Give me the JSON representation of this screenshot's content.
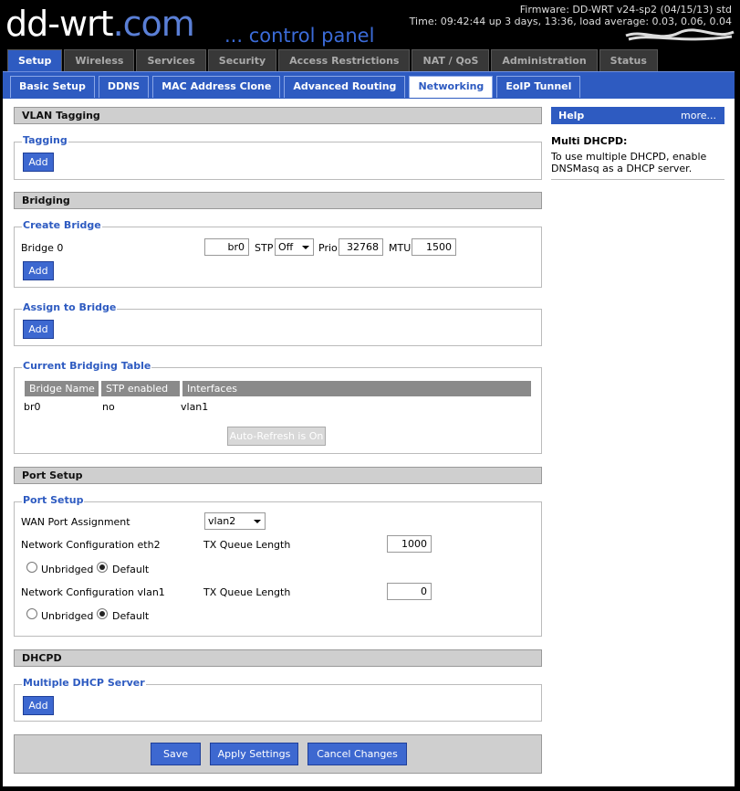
{
  "header": {
    "logo_main": "dd-wrt",
    "logo_dot": ".com",
    "tagline": "... control panel",
    "firmware": "Firmware: DD-WRT v24-sp2 (04/15/13) std",
    "status_line": "Time: 09:42:44 up 3 days, 13:36, load average: 0.03, 0.06, 0.04"
  },
  "main_tabs": [
    "Setup",
    "Wireless",
    "Services",
    "Security",
    "Access Restrictions",
    "NAT / QoS",
    "Administration",
    "Status"
  ],
  "sub_tabs": [
    "Basic Setup",
    "DDNS",
    "MAC Address Clone",
    "Advanced Routing",
    "Networking",
    "EoIP Tunnel"
  ],
  "vlan": {
    "section_title": "VLAN Tagging",
    "group_title": "Tagging",
    "add_label": "Add"
  },
  "bridging": {
    "section_title": "Bridging",
    "create_group": "Create Bridge",
    "bridge_label": "Bridge 0",
    "bridge_name": "br0",
    "stp_label": "STP",
    "stp_value": "Off",
    "prio_label": "Prio",
    "prio_value": "32768",
    "mtu_label": "MTU",
    "mtu_value": "1500",
    "add_label": "Add",
    "assign_group": "Assign to Bridge",
    "assign_add_label": "Add",
    "table_group": "Current Bridging Table",
    "table_headers": [
      "Bridge Name",
      "STP enabled",
      "Interfaces"
    ],
    "table_row": [
      "br0",
      "no",
      "vlan1"
    ],
    "autorefresh_label": "Auto-Refresh is On"
  },
  "port": {
    "section_title": "Port Setup",
    "group_title": "Port Setup",
    "wan_label": "WAN Port Assignment",
    "wan_value": "vlan2",
    "eth2_label": "Network Configuration eth2",
    "txq_label": "TX Queue Length",
    "eth2_txq": "1000",
    "unbridged_label": "Unbridged",
    "default_label": "Default",
    "vlan1_label": "Network Configuration vlan1",
    "vlan1_txq": "0"
  },
  "dhcpd": {
    "section_title": "DHCPD",
    "group_title": "Multiple DHCP Server",
    "add_label": "Add"
  },
  "footer": {
    "save": "Save",
    "apply": "Apply Settings",
    "cancel": "Cancel Changes"
  },
  "help": {
    "title": "Help",
    "more": "more...",
    "topic": "Multi DHCPD:",
    "text": "To use multiple DHCPD, enable DNSMasq as a DHCP server."
  },
  "colors": {
    "accent": "#2e5bc1",
    "button": "#3d68d0",
    "section_bg": "#cfcfcf"
  }
}
